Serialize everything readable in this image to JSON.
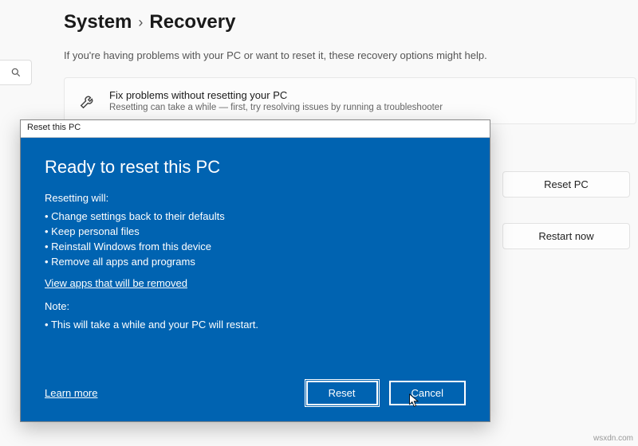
{
  "breadcrumb": {
    "parent": "System",
    "current": "Recovery"
  },
  "subtitle": "If you're having problems with your PC or want to reset it, these recovery options might help.",
  "card": {
    "title": "Fix problems without resetting your PC",
    "sub": "Resetting can take a while — first, try resolving issues by running a troubleshooter"
  },
  "side": {
    "reset": "Reset PC",
    "restart": "Restart now"
  },
  "dialog": {
    "window_title": "Reset this PC",
    "heading": "Ready to reset this PC",
    "reset_label": "Resetting will:",
    "bullets": [
      "Change settings back to their defaults",
      "Keep personal files",
      "Reinstall Windows from this device",
      "Remove all apps and programs"
    ],
    "view_apps": "View apps that will be removed",
    "note_label": "Note:",
    "note_items": [
      "This will take a while and your PC will restart."
    ],
    "learn_more": "Learn more",
    "reset_btn": "Reset",
    "cancel_btn": "Cancel"
  },
  "watermark": "wsxdn.com"
}
